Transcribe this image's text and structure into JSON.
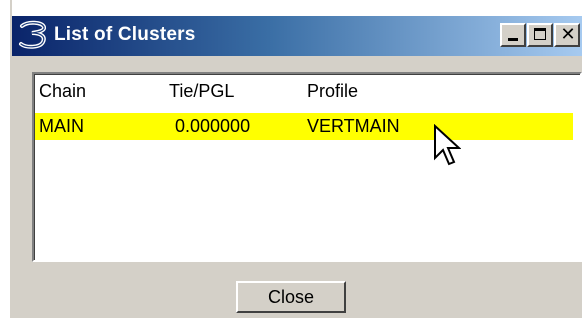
{
  "window": {
    "title": "List of Clusters",
    "app_icon": "app-logo-icon",
    "controls": {
      "minimize": "minimize-icon",
      "maximize": "maximize-icon",
      "close": "close-icon"
    }
  },
  "list": {
    "columns": [
      "Chain",
      "Tie/PGL",
      "Profile"
    ],
    "rows": [
      {
        "chain": "MAIN",
        "tie_pgl": "0.000000",
        "profile": "VERTMAIN",
        "selected": true
      }
    ],
    "selection_color": "#ffff00"
  },
  "buttons": {
    "close_label": "Close"
  }
}
